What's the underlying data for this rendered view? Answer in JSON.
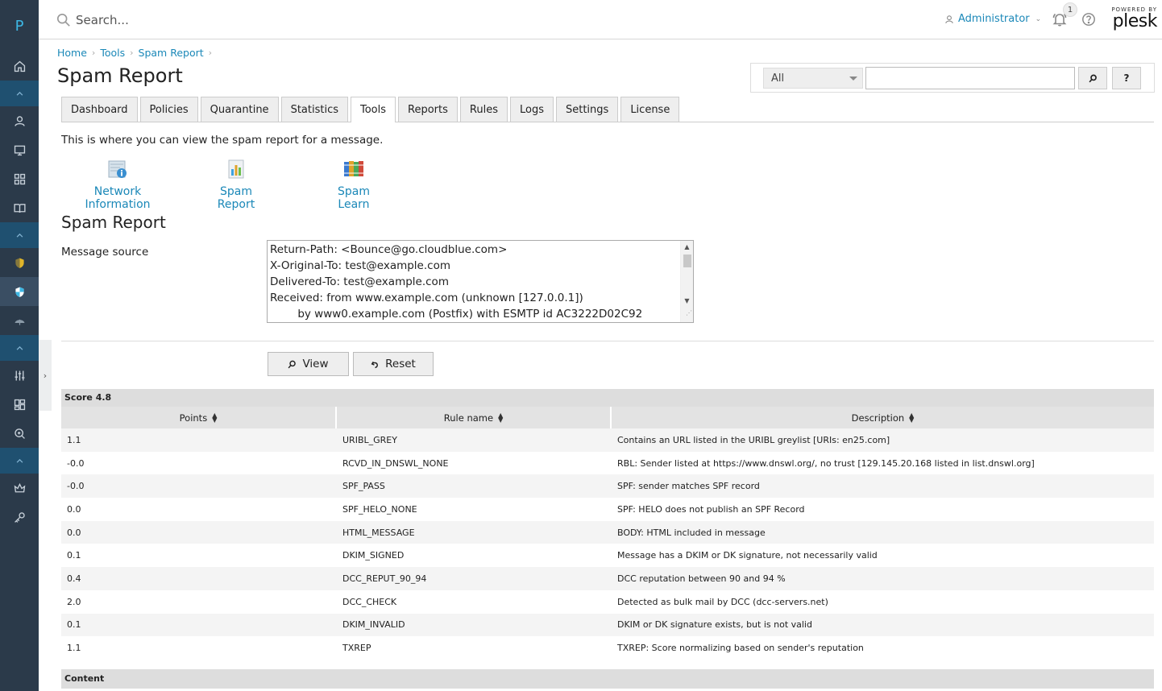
{
  "rail": {
    "logo": "P",
    "icons": [
      "home-icon",
      "collapse-icon",
      "user-icon",
      "monitor-icon",
      "apps-icon",
      "book-icon",
      "collapse-icon",
      "shield-yellow-icon",
      "shield-blue-icon",
      "umbrella-icon",
      "collapse-icon",
      "sliders-icon",
      "dashboard-icon",
      "search-doc-icon",
      "collapse-icon",
      "crown-icon",
      "key-icon"
    ],
    "toggle": "›"
  },
  "header": {
    "search_placeholder": "Search...",
    "user": "Administrator",
    "notifications_count": "1",
    "powered_by": "POWERED BY",
    "brand": "plesk"
  },
  "breadcrumb": [
    "Home",
    "Tools",
    "Spam Report"
  ],
  "page_title": "Spam Report",
  "top_search": {
    "filter_value": "All",
    "help_label": "?"
  },
  "tabs": [
    "Dashboard",
    "Policies",
    "Quarantine",
    "Statistics",
    "Tools",
    "Reports",
    "Rules",
    "Logs",
    "Settings",
    "License"
  ],
  "active_tab": "Tools",
  "intro": "This is where you can view the spam report for a message.",
  "tools": [
    {
      "label": "Network Information",
      "icon": "network-info-icon"
    },
    {
      "label": "Spam Report",
      "icon": "spam-report-icon"
    },
    {
      "label": "Spam Learn",
      "icon": "spam-learn-icon"
    }
  ],
  "section_title": "Spam Report",
  "message_source": {
    "label": "Message source",
    "lines": [
      "Return-Path: <Bounce@go.cloudblue.com>",
      "X-Original-To: test@example.com",
      "Delivered-To: test@example.com",
      "Received: from www.example.com (unknown [127.0.0.1])",
      "        by www0.example.com (Postfix) with ESMTP id AC3222D02C92"
    ]
  },
  "buttons": {
    "view": "View",
    "reset": "Reset"
  },
  "score_label": "Score 4.8",
  "table": {
    "headers": [
      "Points",
      "Rule name",
      "Description"
    ],
    "rows": [
      [
        "1.1",
        "URIBL_GREY",
        "Contains an URL listed in the URIBL greylist [URIs: en25.com]"
      ],
      [
        "-0.0",
        "RCVD_IN_DNSWL_NONE",
        "RBL: Sender listed at https://www.dnswl.org/, no trust [129.145.20.168 listed in list.dnswl.org]"
      ],
      [
        "-0.0",
        "SPF_PASS",
        "SPF: sender matches SPF record"
      ],
      [
        "0.0",
        "SPF_HELO_NONE",
        "SPF: HELO does not publish an SPF Record"
      ],
      [
        "0.0",
        "HTML_MESSAGE",
        "BODY: HTML included in message"
      ],
      [
        "0.1",
        "DKIM_SIGNED",
        "Message has a DKIM or DK signature, not necessarily valid"
      ],
      [
        "0.4",
        "DCC_REPUT_90_94",
        "DCC reputation between 90 and 94 %"
      ],
      [
        "2.0",
        "DCC_CHECK",
        "Detected as bulk mail by DCC (dcc-servers.net)"
      ],
      [
        "0.1",
        "DKIM_INVALID",
        "DKIM or DK signature exists, but is not valid"
      ],
      [
        "1.1",
        "TXREP",
        "TXREP: Score normalizing based on sender's reputation"
      ]
    ]
  },
  "content_label": "Content",
  "colors": {
    "rail": "#2b3a4a",
    "rail_collapse": "#1f5070",
    "link": "#1b88b8"
  }
}
